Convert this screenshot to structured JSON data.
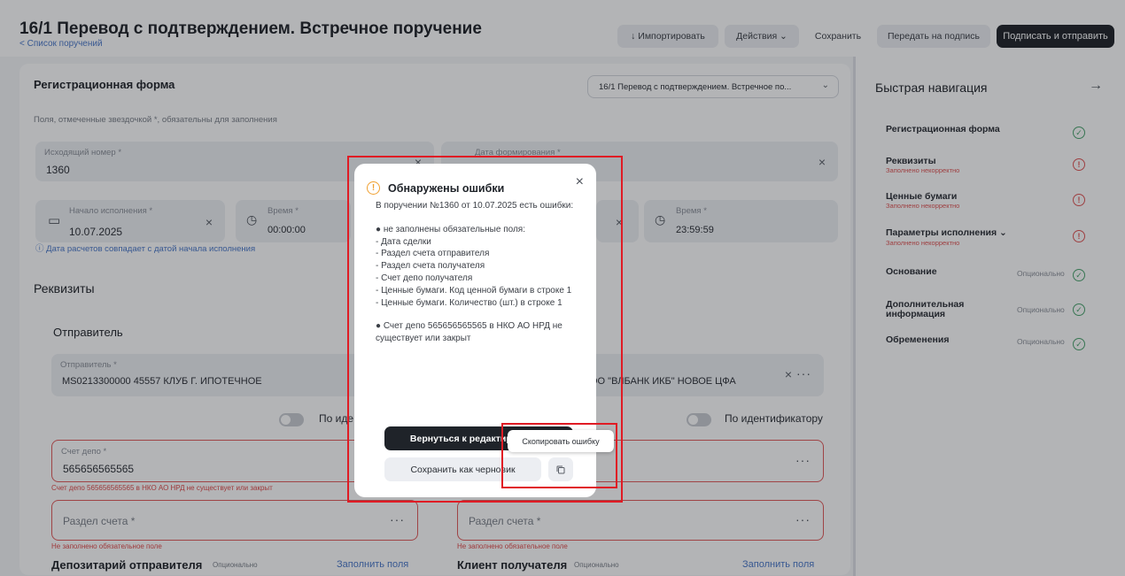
{
  "header": {
    "title": "16/1 Перевод с подтверждением. Встречное поручение",
    "back_link": "< Список поручений",
    "buttons": {
      "import": "↓ Импортировать",
      "actions": "Действия ⌄",
      "save": "Сохранить",
      "send_to_sign": "Передать на подпись",
      "sign_and_send": "Подписать и отправить"
    }
  },
  "form": {
    "section_title": "Регистрационная форма",
    "template_select": "16/1 Перевод с подтверждением. Встречное по...",
    "required_note": "Поля, отмеченные звездочкой *, обязательны для заполнения",
    "outgoing_number": {
      "label": "Исходящий номер *",
      "value": "1360"
    },
    "formation_date": {
      "label": "Дата формирования *"
    },
    "start_date": {
      "label": "Начало исполнения *",
      "value": "10.07.2025"
    },
    "start_time": {
      "label": "Время *",
      "value": "00:00:00"
    },
    "end_time": {
      "label": "Время *",
      "value": "23:59:59"
    },
    "settlement_hint": "ⓘ Дата расчетов совпадает с датой начала исполнения"
  },
  "requisites": {
    "title": "Реквизиты",
    "sender_title": "Отправитель",
    "sender": {
      "label": "Отправитель *",
      "value": "MS0213300000 45557 КЛУБ Г. ИПОТЕЧНОЕ"
    },
    "receiver_value": "ОО \"ВЛБАНК ИКБ\" НОВОЕ ЦФА",
    "by_identifier_left": "По иде",
    "by_identifier_right": "По идентификатору",
    "depo_account": {
      "label": "Счет депо *",
      "value": "565656565565"
    },
    "depo_error": "Счет депо 565656565565 в НКО АО НРД не существует или закрыт",
    "account_section_left": "Раздел счета *",
    "account_section_right": "Раздел счета *",
    "required_error": "Не заполнено обязательное поле",
    "depositary_title": "Депозитарий отправителя",
    "optional": "Опционально",
    "fill_fields": "Заполнить поля",
    "client_title": "Клиент получателя"
  },
  "quick_nav": {
    "title": "Быстрая навигация",
    "arrow": "→",
    "items": [
      {
        "label": "Регистрационная форма",
        "sub": "",
        "opt": "",
        "status": "ok"
      },
      {
        "label": "Реквизиты",
        "sub": "Заполнено некорректно",
        "opt": "",
        "status": "bad"
      },
      {
        "label": "Ценные бумаги",
        "sub": "Заполнено некорректно",
        "opt": "",
        "status": "bad"
      },
      {
        "label": "Параметры исполнения ⌄",
        "sub": "Заполнено некорректно",
        "opt": "",
        "status": "bad"
      },
      {
        "label": "Основание",
        "sub": "",
        "opt": "Опционально",
        "status": "ok"
      },
      {
        "label": "Дополнительная информация",
        "sub": "",
        "opt": "Опционально",
        "status": "ok"
      },
      {
        "label": "Обременения",
        "sub": "",
        "opt": "Опционально",
        "status": "ok"
      }
    ]
  },
  "modal": {
    "title": "Обнаружены ошибки",
    "close": "×",
    "intro": "В поручении №1360 от 10.07.2025 есть ошибки:",
    "bullet1": "● не заполнены обязательные поля:",
    "fields": [
      "- Дата сделки",
      "- Раздел счета отправителя",
      "- Раздел счета получателя",
      "- Счет депо получателя",
      "- Ценные бумаги. Код ценной бумаги в строке 1",
      "- Ценные бумаги. Количество (шт.) в строке 1"
    ],
    "bullet2": "● Счет депо 565656565565 в НКО АО НРД не существует или закрыт",
    "back_button": "Вернуться к редактированию",
    "draft_button": "Сохранить как черновик",
    "copy_tooltip": "Скопировать ошибку"
  },
  "colors": {
    "accent_dark": "#1f2329",
    "error_red": "#e05353",
    "highlight_red": "#e01b24",
    "link_blue": "#4a78c9",
    "ok_green": "#49a36c",
    "warning_orange": "#f0a030"
  }
}
